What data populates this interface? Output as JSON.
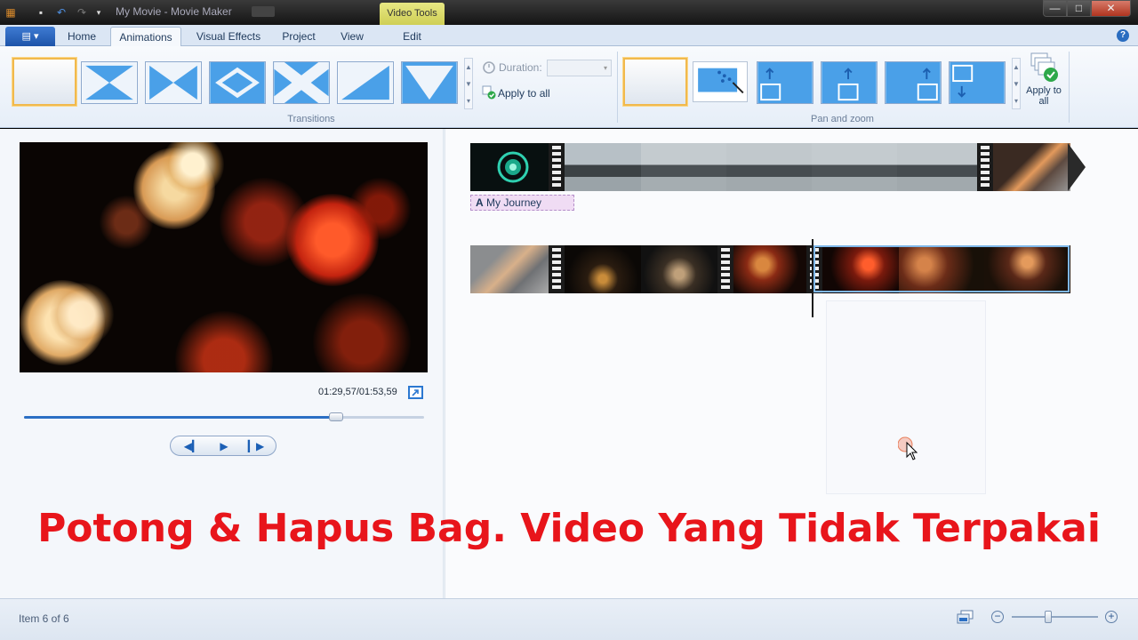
{
  "window": {
    "title": "My Movie - Movie Maker",
    "context_tab": "Video Tools",
    "min_glyph": "—",
    "max_glyph": "□",
    "close_glyph": "✕"
  },
  "quick_access": {
    "save_icon": "save-icon",
    "undo_icon": "undo-icon",
    "redo_icon": "redo-icon",
    "customize_icon": "dropdown-icon"
  },
  "file_button": {
    "glyph": "▤ ▾"
  },
  "tabs": [
    "Home",
    "Animations",
    "Visual Effects",
    "Project",
    "View",
    "Edit"
  ],
  "active_tab": "Animations",
  "help_glyph": "?",
  "ribbon": {
    "transitions_label": "Transitions",
    "pan_zoom_label": "Pan and zoom",
    "duration_label": "Duration:",
    "duration_value": "",
    "apply_to_all": "Apply to all",
    "apply_to_all_big": "Apply to all",
    "scroll_up": "▲",
    "scroll_down": "▼",
    "scroll_more": "▾"
  },
  "preview": {
    "timecode": "01:29,57/01:53,59",
    "progress": 0.78,
    "prev_glyph": "◀▎",
    "play_glyph": "▶",
    "next_glyph": "▎▶"
  },
  "timeline": {
    "caption_title": "My Journey",
    "caption_glyph": "A"
  },
  "overlay_caption": "Potong & Hapus Bag. Video Yang Tidak Terpakai",
  "status": {
    "item_text": "Item 6 of 6",
    "zoom_out_glyph": "−",
    "zoom_in_glyph": "+",
    "zoom_level": 0.42
  },
  "colors": {
    "accent": "#2b6fc4",
    "caption_red": "#e8151b",
    "selection": "#f1b94d"
  }
}
